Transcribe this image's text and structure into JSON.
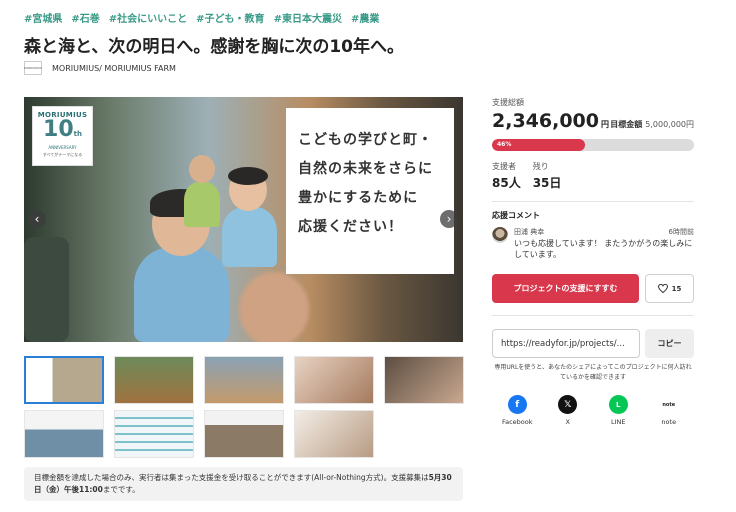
{
  "tags": [
    "#宮城県",
    "#石巻",
    "#社会にいいこと",
    "#子ども・教育",
    "#東日本大震災",
    "#農業"
  ],
  "title": "森と海と、次の明日へ。感謝を胸に次の10年へ。",
  "owner": {
    "logo_text": "MORIUMIUS",
    "name": "MORIUMIUS/ MORIUMIUS FARM"
  },
  "hero": {
    "badge": {
      "brand": "MORIUMIUS",
      "number": "10",
      "suffix": "th",
      "label": "ANNIVERSARY",
      "tagline": "すべてがテーマになる"
    },
    "card_lines": [
      "こどもの学びと町・",
      "自然の未来をさらに",
      "豊かにするために",
      "応援ください！"
    ],
    "prev_icon": "‹",
    "next_icon": "›"
  },
  "thumbnails_count": 9,
  "notice": {
    "text": "目標金額を達成した場合のみ、実行者は集まった支援金を受け取ることができます(All-or-Nothing方式)。支援募集は",
    "deadline": "5月30日（金）午後11:00",
    "suffix": "までです。"
  },
  "funding": {
    "raised_label": "支援総額",
    "raised_amount": "2,346,000",
    "currency": "円",
    "goal_label": "目標金額",
    "goal_amount": "5,000,000円",
    "progress_text": "46%",
    "progress_fraction": 0.46,
    "supporters_label": "支援者",
    "supporters_value": "85人",
    "remaining_label": "残り",
    "remaining_value": "35日"
  },
  "comments": {
    "heading": "応援コメント",
    "items": [
      {
        "author": "田浦 典幸",
        "time": "6時間前",
        "text": "いつも応援しています！ またうかがうの楽しみにしています。"
      }
    ]
  },
  "actions": {
    "support_label": "プロジェクトの支援にすすむ",
    "like_icon": "heart-icon",
    "like_count": "15"
  },
  "share": {
    "url": "https://readyfor.jp/projects/...",
    "copy_label": "コピー",
    "note": "専用URLを使うと、あなたのシェアによってこのプロジェクトに何人訪れているかを確認できます",
    "sns": [
      {
        "name": "Facebook",
        "glyph": "f",
        "color": "#1877f2"
      },
      {
        "name": "X",
        "glyph": "𝕏",
        "color": "#111111"
      },
      {
        "name": "LINE",
        "glyph": "L",
        "color": "#06c755"
      },
      {
        "name": "note",
        "glyph": "note",
        "color": "#ffffff"
      }
    ]
  },
  "colors": {
    "accent": "#d9374b",
    "tag": "#3a9a88",
    "thumb_active": "#2a7fd4"
  }
}
